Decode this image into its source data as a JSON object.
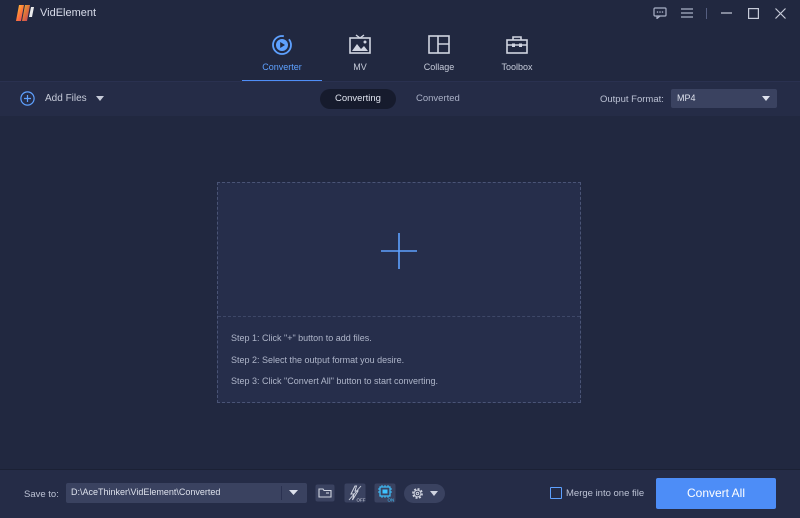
{
  "app": {
    "title": "VidElement"
  },
  "main_tabs": [
    {
      "label": "Converter",
      "icon": "converter-icon",
      "active": true
    },
    {
      "label": "MV",
      "icon": "mv-icon",
      "active": false
    },
    {
      "label": "Collage",
      "icon": "collage-icon",
      "active": false
    },
    {
      "label": "Toolbox",
      "icon": "toolbox-icon",
      "active": false
    }
  ],
  "toolbar": {
    "add_files_label": "Add Files",
    "subtabs": [
      {
        "label": "Converting",
        "active": true
      },
      {
        "label": "Converted",
        "active": false
      }
    ],
    "output_format_label": "Output Format:",
    "output_format_value": "MP4"
  },
  "dropzone": {
    "steps": [
      "Step 1: Click \"+\" button to add files.",
      "Step 2: Select the output format you desire.",
      "Step 3: Click \"Convert All\" button to start converting."
    ]
  },
  "bottom": {
    "save_to_label": "Save to:",
    "save_path": "D:\\AceThinker\\VidElement\\Converted",
    "merge_label": "Merge into one file",
    "merge_checked": false,
    "convert_all_label": "Convert All",
    "hw_accel_off_label": "OFF",
    "gpu_on_label": "ON"
  },
  "colors": {
    "accent": "#4d8df7",
    "background": "#212840",
    "panel": "#252c47"
  }
}
